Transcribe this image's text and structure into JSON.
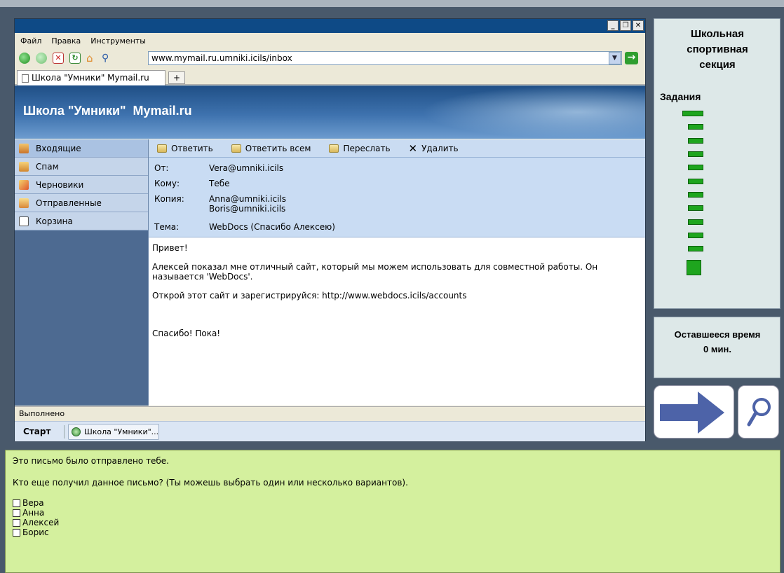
{
  "browser": {
    "menu": [
      "Файл",
      "Правка",
      "Инструменты"
    ],
    "window_buttons": [
      "_",
      "❐",
      "✕"
    ],
    "address": "www.mymail.ru.umniki.icils/inbox",
    "tab_label": "Школа \"Умники\" Mymail.ru",
    "new_tab": "+",
    "status": "Выполнено",
    "start": "Старт",
    "taskbar_item": "Школа \"Умники\"..."
  },
  "mail": {
    "banner_title": "Школа \"Умники\"  Mymail.ru",
    "folders": [
      "Входящие",
      "Спам",
      "Черновики",
      "Отправленные",
      "Корзина"
    ],
    "actions": {
      "reply": "Ответить",
      "reply_all": "Ответить всем",
      "forward": "Переслать",
      "delete": "Удалить"
    },
    "header": {
      "from_label": "От:",
      "from": "Vera@umniki.icils",
      "to_label": "Кому:",
      "to": "Тебе",
      "cc_label": "Копия:",
      "cc1": "Anna@umniki.icils",
      "cc2": "Boris@umniki.icils",
      "subject_label": "Тема:",
      "subject": "WebDocs (Спасибо Алексею)"
    },
    "body": {
      "greeting": "Привет!",
      "p1": "Алексей показал мне отличный сайт, который мы можем использовать для совместной работы. Он называется 'WebDocs'.",
      "p2": "Открой этот сайт и зарегистрируйся: http://www.webdocs.icils/accounts",
      "closing": "Спасибо! Пока!"
    }
  },
  "panel": {
    "title_line1": "Школьная",
    "title_line2": "спортивная",
    "title_line3": "секция",
    "tasks_label": "Задания",
    "time_label": "Оставшееся время",
    "time_value": "0 мин."
  },
  "question": {
    "line1": "Это письмо было отправлено тебе.",
    "line2": "Кто еще получил данное письмо? (Ты можешь выбрать один или несколько вариантов).",
    "options": [
      "Вера",
      "Анна",
      "Алексей",
      "Борис"
    ]
  },
  "colors": {
    "banner": "#3e72ae",
    "sidebar": "#4d6a91",
    "question_bg": "#d4f09e",
    "task_bar": "#1ea51e",
    "arrow": "#4d63a8"
  }
}
